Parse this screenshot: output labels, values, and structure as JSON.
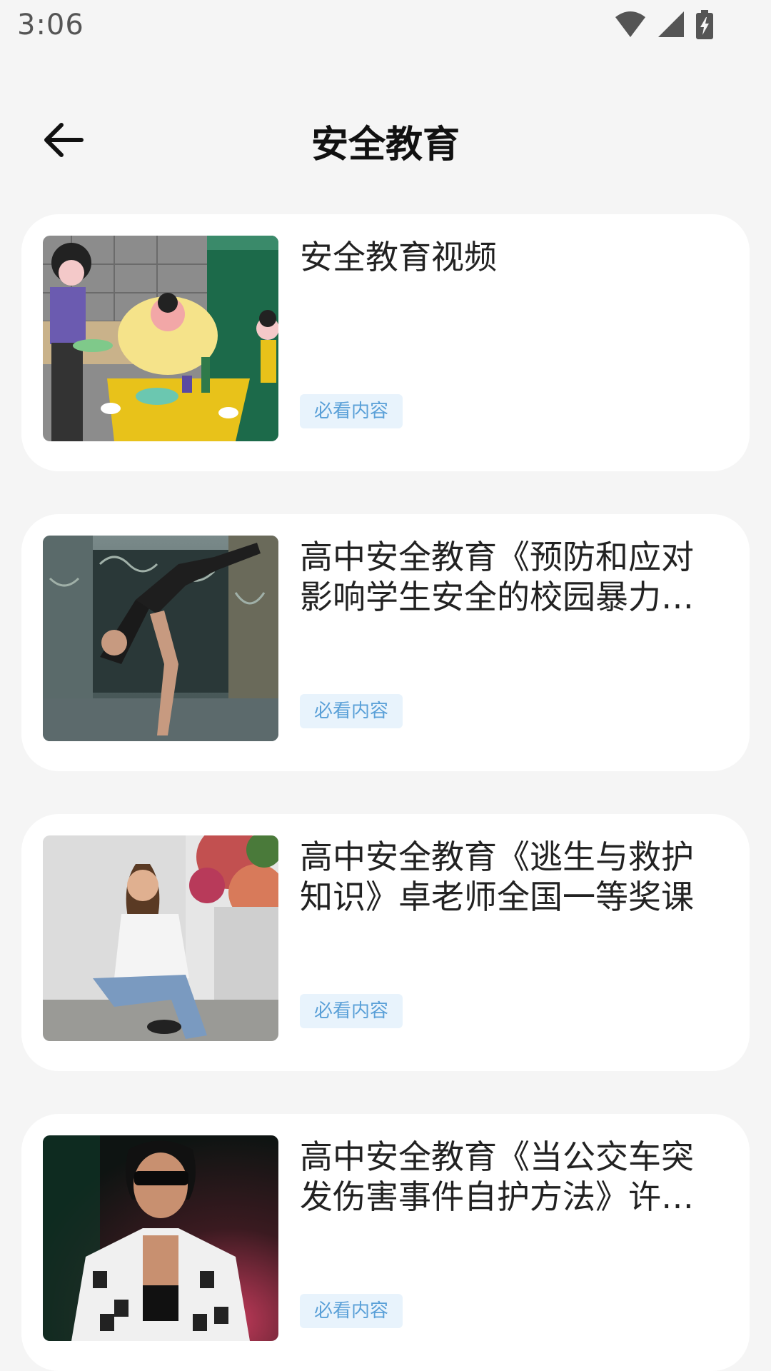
{
  "status_bar": {
    "time": "3:06",
    "icons": [
      "wifi-icon",
      "cellular-signal-icon",
      "battery-charging-icon"
    ]
  },
  "header": {
    "back_icon": "arrow-left-icon",
    "title": "安全教育"
  },
  "items": [
    {
      "title": "安全教育视频",
      "tag": "必看内容",
      "thumb": "illustration-family-dinner"
    },
    {
      "title": "高中安全教育《预防和应对影响学生安全的校园暴力事件》",
      "tag": "必看内容",
      "thumb": "photo-breakdancer"
    },
    {
      "title": "高中安全教育《逃生与救护知识》卓老师全国一等奖课",
      "tag": "必看内容",
      "thumb": "photo-woman-crouching"
    },
    {
      "title": "高中安全教育《当公交车突发伤害事件自护方法》许老师",
      "tag": "必看内容",
      "thumb": "photo-woman-sunglasses"
    }
  ],
  "colors": {
    "background": "#f5f5f5",
    "card": "#ffffff",
    "tag_bg": "#e8f3fc",
    "tag_text": "#5aa0d8"
  }
}
